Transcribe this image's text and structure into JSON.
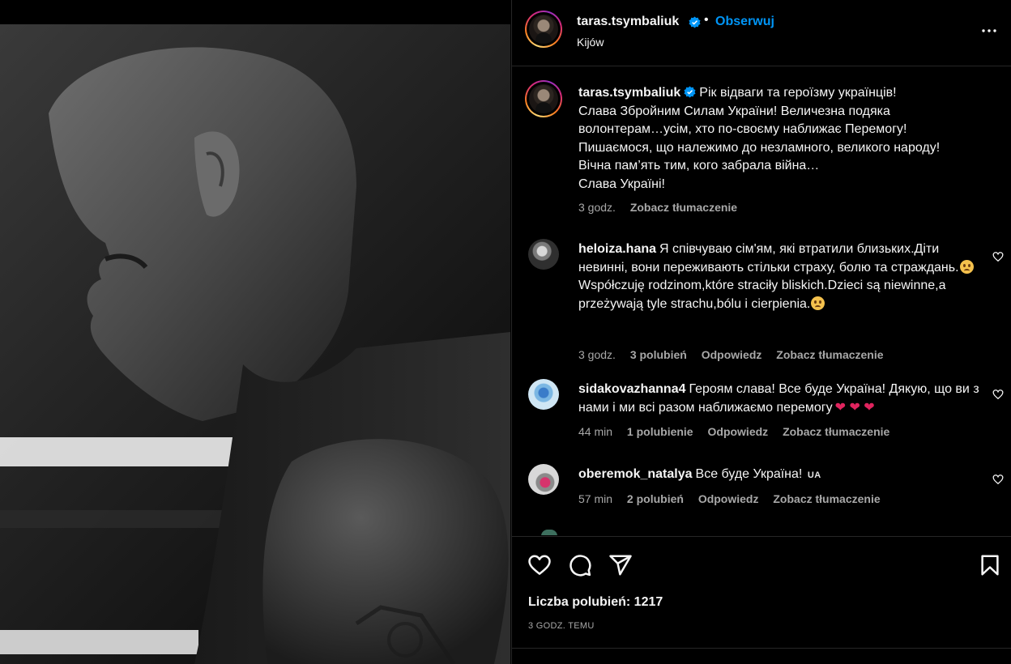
{
  "post": {
    "username": "taras.tsymbaliuk",
    "verified": true,
    "separator": "•",
    "follow_label": "Obserwuj",
    "location": "Kijów",
    "more_icon": "more-horizontal-icon"
  },
  "caption": {
    "username": "taras.tsymbaliuk",
    "text_lines": [
      "Рік відваги та героїзму українців!",
      "Слава Збройним Силам України! Величезна подяка",
      "волонтерам…усім, хто по-своєму наближає Перемогу!",
      "Пишаємося, що належимо до незламного, великого народу!",
      "Вічна пам’ять тим, кого забрала війна…",
      "Слава Україні!"
    ],
    "time": "3 godz.",
    "translate_label": "Zobacz tłumaczenie"
  },
  "comments": [
    {
      "username": "heloiza.hana",
      "text_part1": "Я співчуваю сім'ям, які втратили близьких.Діти невинні, вони переживають стільки страху, болю та страждань.",
      "text_part2": " Współczuję rodzinom,które straciły bliskich.Dzieci są niewinne,a przeżywają tyle strachu,bólu i cierpienia.",
      "emoji": "worried-face-emoji",
      "time": "3 godz.",
      "likes": "3 polubień",
      "reply_label": "Odpowiedz",
      "translate_label": "Zobacz tłumaczenie"
    },
    {
      "username": "sidakovazhanna4",
      "text": "Героям слава! Все буде Україна! Дякую, що ви з нами і ми всі разом наближаємо перемогу",
      "hearts": "❤ ❤ ❤",
      "time": "44 min",
      "likes": "1 polubienie",
      "reply_label": "Odpowiedz",
      "translate_label": "Zobacz tłumaczenie"
    },
    {
      "username": "oberemok_natalya",
      "text": "Все буде Україна!",
      "flag": "UA",
      "time": "57 min",
      "likes": "2 polubień",
      "reply_label": "Odpowiedz",
      "translate_label": "Zobacz tłumaczenie"
    }
  ],
  "actions": {
    "like_icon": "heart-outline-icon",
    "comment_icon": "comment-bubble-icon",
    "share_icon": "paper-plane-icon",
    "save_icon": "bookmark-icon"
  },
  "likes_label": "Liczba polubień: 1217",
  "post_time": "3 GODZ. TEMU",
  "colors": {
    "background": "#000000",
    "text": "#f5f5f5",
    "secondary_text": "#a8a8a8",
    "link_blue": "#0095f6",
    "divider": "#262626",
    "heart_red": "#e0245e"
  }
}
